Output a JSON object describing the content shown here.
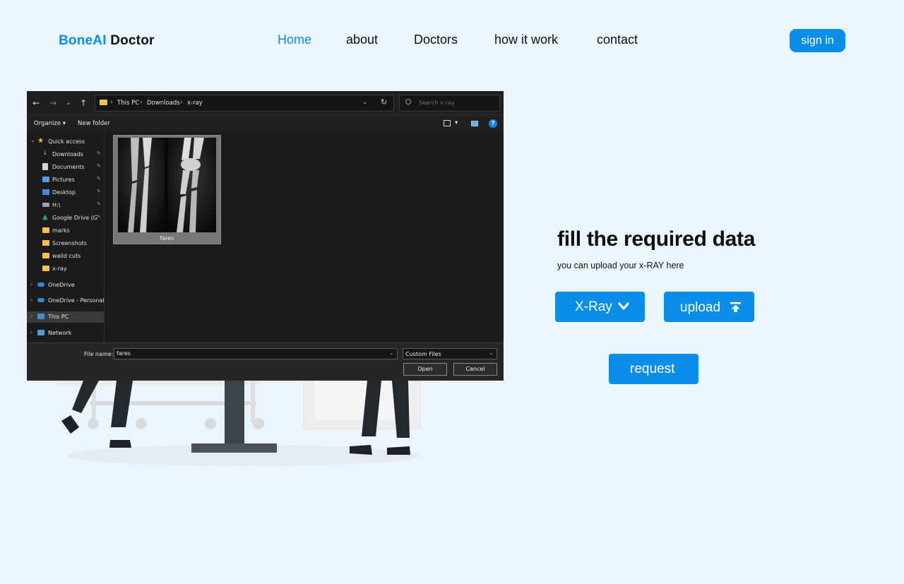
{
  "header": {
    "logo_part1": "BoneAI",
    "logo_part2": "Doctor",
    "nav": [
      "Home",
      "about",
      "Doctors",
      "how it work",
      "contact"
    ],
    "active_nav": "Home",
    "signin_label": "sign in"
  },
  "dialog": {
    "path": [
      "This PC",
      "Downloads",
      "x-ray"
    ],
    "search_placeholder": "Search x-ray",
    "toolbar": {
      "organize": "Organize",
      "new_folder": "New folder"
    },
    "sidebar": {
      "quick_access": "Quick access",
      "pinned": [
        "Downloads",
        "Documents",
        "Pictures",
        "Desktop",
        "H:\\",
        "Google Drive (G"
      ],
      "folders": [
        "marks",
        "Screenshots",
        "walid cuts",
        "x-ray"
      ],
      "onedrive": "OneDrive",
      "onedrive_personal": "OneDrive - Personal",
      "this_pc": "This PC",
      "network": "Network"
    },
    "file": {
      "name": "fares"
    },
    "footer": {
      "file_name_label": "File name:",
      "file_name_value": "fares",
      "file_type": "Custom Files",
      "open_label": "Open",
      "cancel_label": "Cancel"
    }
  },
  "panel": {
    "title": "fill the required data",
    "subtitle": "you can upload your x-RAY here",
    "xray_label": "X-Ray",
    "upload_label": "upload",
    "request_label": "request"
  },
  "colors": {
    "accent": "#0a8ee8",
    "background": "#eaf5fd",
    "dialog_bg": "#1b1b1b"
  },
  "icons": [
    "back-arrow-icon",
    "forward-arrow-icon",
    "up-arrow-icon",
    "folder-icon",
    "refresh-icon",
    "search-icon",
    "view-icon",
    "help-icon",
    "star-icon",
    "pin-icon",
    "onedrive-cloud-icon",
    "computer-icon",
    "network-icon",
    "chevron-down-icon",
    "upload-arrow-icon"
  ]
}
